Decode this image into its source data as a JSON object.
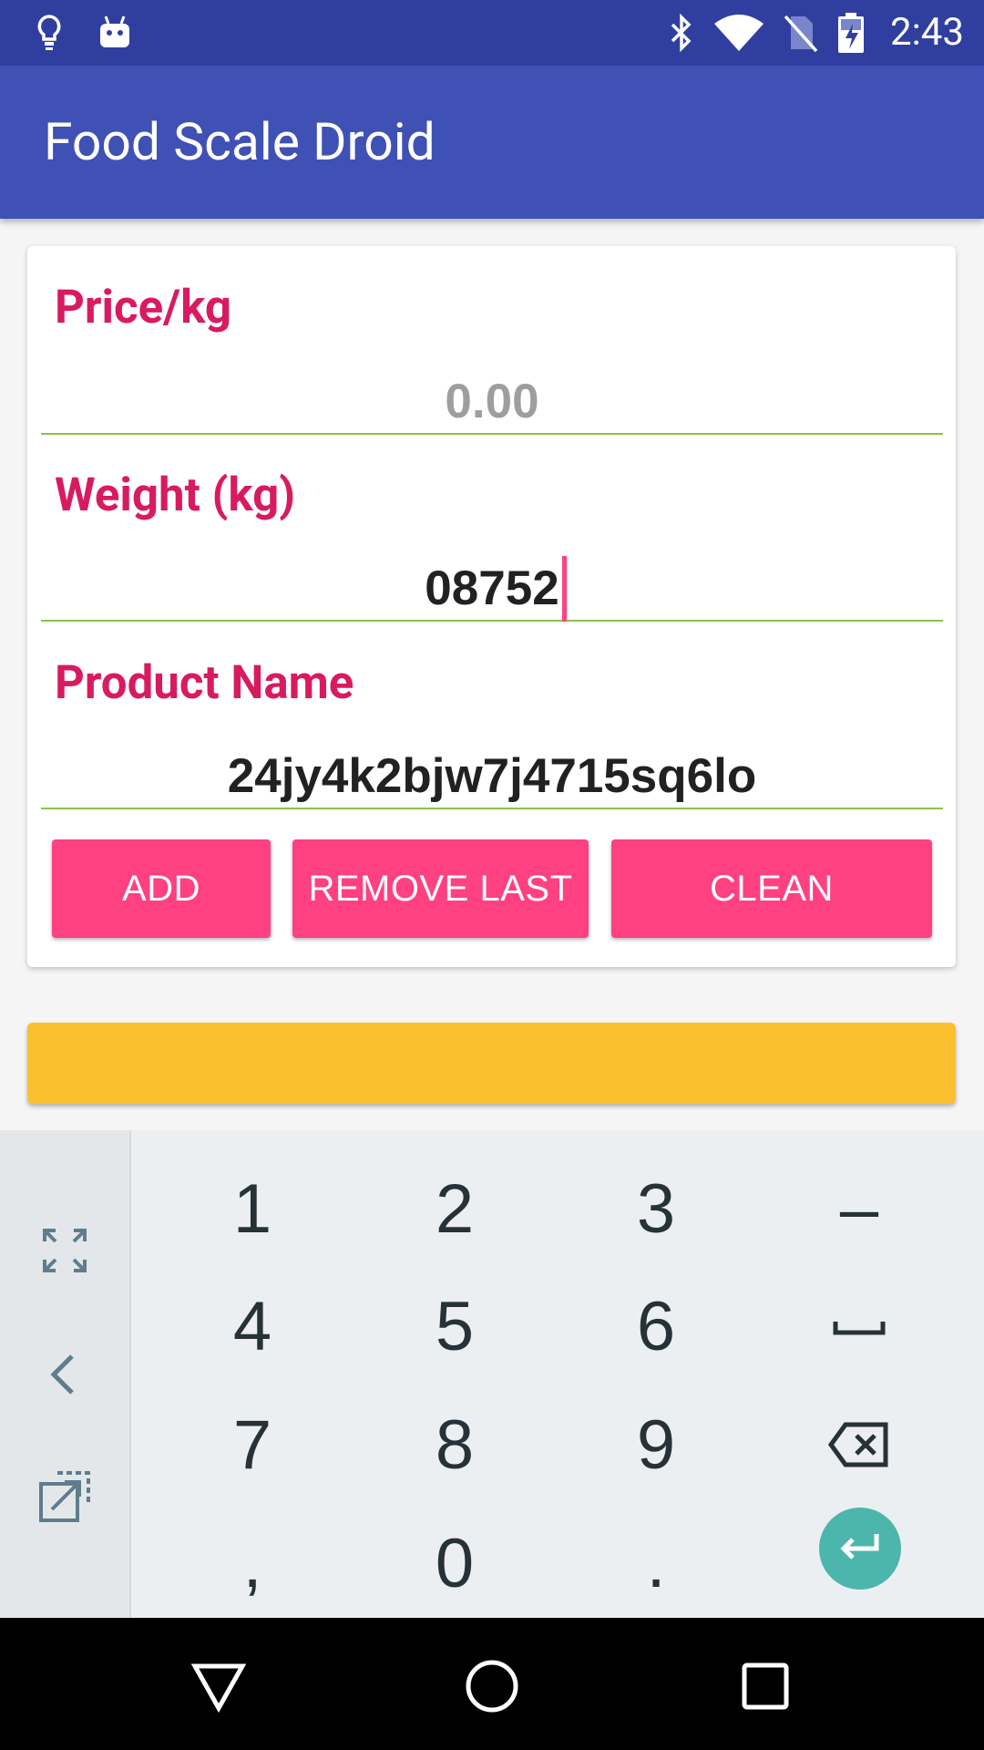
{
  "status_bar": {
    "time": "2:43",
    "icons": [
      "lightbulb-icon",
      "android-icon",
      "bluetooth-icon",
      "wifi-icon",
      "no-sim-icon",
      "battery-charging-icon"
    ]
  },
  "app_bar": {
    "title": "Food Scale Droid"
  },
  "form": {
    "price": {
      "label": "Price/kg",
      "value": "",
      "placeholder": "0.00"
    },
    "weight": {
      "label": "Weight (kg)",
      "value": "08752"
    },
    "product": {
      "label": "Product Name",
      "value": "24jy4k2bjw7j4715sq6lo"
    },
    "buttons": {
      "add": "ADD",
      "remove_last": "REMOVE LAST",
      "clean": "CLEAN"
    }
  },
  "total_bar": {
    "text": ""
  },
  "keyboard": {
    "rows": [
      [
        "1",
        "2",
        "3",
        "–"
      ],
      [
        "4",
        "5",
        "6",
        "space"
      ],
      [
        "7",
        "8",
        "9",
        "backspace"
      ],
      [
        ",",
        "0",
        ".",
        "enter"
      ]
    ],
    "side_keys": [
      "fullscreen-icon",
      "back-arrow-icon",
      "popout-icon"
    ]
  },
  "colors": {
    "status_bar": "#303f9f",
    "app_bar": "#3f51b5",
    "label": "#d81b60",
    "button": "#ff4081",
    "underline": "#8bc34a",
    "total_bar": "#fbc02d",
    "enter_key": "#4db6ac"
  }
}
